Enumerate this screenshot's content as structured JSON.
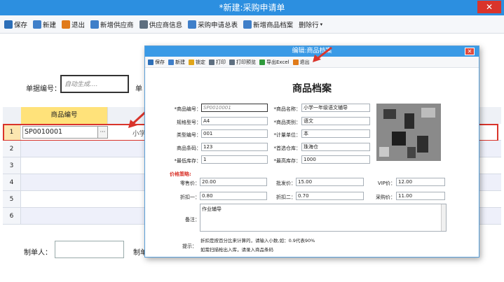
{
  "window": {
    "title": "*新建:采购申请单",
    "close": "✕"
  },
  "toolbar": [
    {
      "label": "保存",
      "color": "#2d6fb8"
    },
    {
      "label": "新建",
      "color": "#3f7fc9"
    },
    {
      "label": "退出",
      "color": "#e07b1a"
    },
    {
      "label": "新增供应商",
      "color": "#3f7fc9"
    },
    {
      "label": "供应商信息",
      "color": "#5e6f80"
    },
    {
      "label": "采购申请总表",
      "color": "#3f7fc9"
    },
    {
      "label": "新增商品档案",
      "color": "#3f7fc9"
    },
    {
      "label": "删除行",
      "color": "#5e6f80"
    }
  ],
  "form": {
    "doc_no_label": "单据编号：",
    "doc_no_placeholder": "自动生成....",
    "doc_label_partial": "单",
    "creator_label": "制单人：",
    "creator_label_2": "制单"
  },
  "grid": {
    "header": "商品编号",
    "rows": [
      "1",
      "2",
      "3",
      "4",
      "5",
      "6"
    ],
    "row1_code": "SP0010001",
    "row1_ellipsis": "···",
    "row1_name_partial": "小学"
  },
  "modal": {
    "title": "编辑:商品档案",
    "toolbar": [
      {
        "label": "保存",
        "color": "#2d6fb8"
      },
      {
        "label": "新建",
        "color": "#3f7fc9"
      },
      {
        "label": "锁定",
        "color": "#e0a51a"
      },
      {
        "label": "打印",
        "color": "#5e6f80"
      },
      {
        "label": "打印预览",
        "color": "#5e6f80"
      },
      {
        "label": "导出Excel",
        "color": "#2f9a3c"
      },
      {
        "label": "退出",
        "color": "#e07b1a"
      }
    ],
    "heading": "商品档案",
    "fields": {
      "code_label": "*商品编号：",
      "code_value": "SP0010001",
      "spec_label": "规格型号：",
      "spec_value": "A4",
      "type_label": "类型编号：",
      "type_value": "001",
      "barcode_label": "商品条码：",
      "barcode_value": "123",
      "minstock_label": "*最低库存：",
      "minstock_value": "1",
      "name_label": "*商品名称：",
      "name_value": "小学一年级语文辅导",
      "category_label": "*商品类别：",
      "category_value": "语文",
      "unit_label": "*计量单位：",
      "unit_value": "本",
      "warehouse_label": "*首选仓库：",
      "warehouse_value": "珠海仓",
      "maxstock_label": "*最高库存：",
      "maxstock_value": "1000"
    },
    "price_section": "价格策略:",
    "prices": {
      "retail_label": "零售价：",
      "retail_value": "20.00",
      "wholesale_label": "批发价：",
      "wholesale_value": "15.00",
      "vip_label": "VIP价：",
      "vip_value": "12.00",
      "disc1_label": "折扣一：",
      "disc1_value": "0.80",
      "disc2_label": "折扣二：",
      "disc2_value": "0.70",
      "purchase_label": "采购价：",
      "purchase_value": "11.00"
    },
    "remark_label": "备注：",
    "remark_value": "作业辅导",
    "tip_label": "提示：",
    "tip_1": "折扣是按百分比来计算的，请输入小数,如：0.9代表90%",
    "tip_2": "如需扫描枪出入库，请录入商品条码"
  },
  "colors": {
    "accent": "#2c8fe0",
    "highlight_border": "#d9342b",
    "grid_header": "#ffe27a"
  }
}
